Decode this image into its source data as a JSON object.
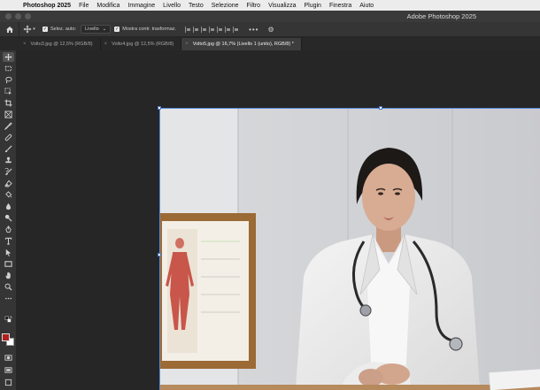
{
  "menubar": {
    "app_name": "Photoshop 2025",
    "items": [
      "File",
      "Modifica",
      "Immagine",
      "Livello",
      "Testo",
      "Selezione",
      "Filtro",
      "Visualizza",
      "Plugin",
      "Finestra",
      "Aiuto"
    ]
  },
  "window": {
    "title": "Adobe Photoshop 2025"
  },
  "options": {
    "auto_select_label": "Selez. auto:",
    "auto_select_value": "Livello",
    "show_transform_label": "Mostra contr. trasformaz."
  },
  "tabs": [
    {
      "label": "Volto3.jpg @ 12,5% (RGB/8)",
      "active": false
    },
    {
      "label": "Volto4.jpg @ 12,5% (RGB/8)",
      "active": false
    },
    {
      "label": "Volto5.jpg @ 16,7% (Livello 1 (unito), RGB/8) *",
      "active": true
    }
  ],
  "colors": {
    "foreground": "#b02020",
    "background": "#ffffff",
    "selection": "#5a8ae0"
  },
  "tools": [
    "move-icon",
    "artboard-icon",
    "lasso-icon",
    "object-select-icon",
    "crop-icon",
    "frame-icon",
    "eyedropper-icon",
    "healing-icon",
    "brush-icon",
    "stamp-icon",
    "history-brush-icon",
    "eraser-icon",
    "bucket-icon",
    "blur-icon",
    "dodge-icon",
    "pen-icon",
    "type-icon",
    "path-select-icon",
    "rectangle-icon",
    "hand-icon",
    "zoom-icon",
    "more-tools-icon"
  ]
}
